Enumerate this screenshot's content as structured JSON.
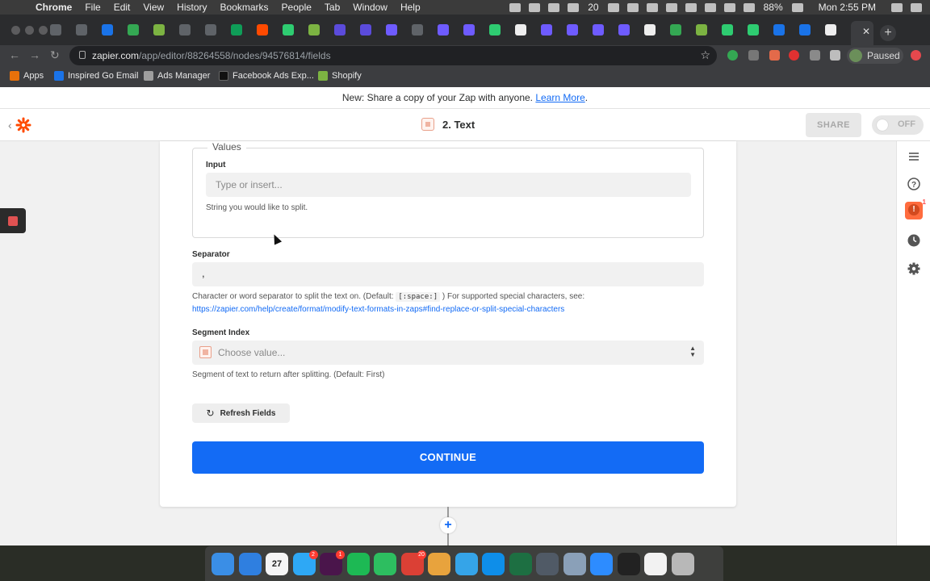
{
  "menubar": {
    "app": "Chrome",
    "items": [
      "File",
      "Edit",
      "View",
      "History",
      "Bookmarks",
      "People",
      "Tab",
      "Window",
      "Help"
    ],
    "badge_count": "20",
    "battery": "88%",
    "clock": "Mon 2:55 PM"
  },
  "tabs": {
    "colors": [
      "#5f6368",
      "#5f6368",
      "#1a73e8",
      "#34a853",
      "#7cb342",
      "#5f6368",
      "#5f6368",
      "#0f9d58",
      "#ff4a00",
      "#2ecc71",
      "#7cb342",
      "#5b4bdb",
      "#5b4bdb",
      "#6e5bff",
      "#5f6368",
      "#6e5bff",
      "#6e5bff",
      "#2ecc71",
      "#eeeeee",
      "#6e5bff",
      "#6e5bff",
      "#6e5bff",
      "#6e5bff",
      "#eeeeee",
      "#34a853",
      "#7cb342",
      "#2ecc71",
      "#2ecc71",
      "#1a73e8",
      "#1a73e8",
      "#eeeeee",
      "#1a73e8"
    ],
    "close_glyph": "✕",
    "new_tab_glyph": "+"
  },
  "address": {
    "host": "zapier.com",
    "path": "/app/editor/88264558/nodes/94576814/fields",
    "profile_status": "Paused"
  },
  "bookmarks": [
    {
      "label": "Apps",
      "color": "#e8710a"
    },
    {
      "label": "Inspired Go Email",
      "color": "#1a73e8"
    },
    {
      "label": "Ads Manager",
      "color": "#9e9e9e"
    },
    {
      "label": "Facebook Ads Exp...",
      "color": "#111111"
    },
    {
      "label": "Shopify",
      "color": "#7cb342"
    }
  ],
  "banner": {
    "text": "New: Share a copy of your Zap with anyone.",
    "link": "Learn More",
    "suffix": "."
  },
  "editor": {
    "step_title": "2. Text",
    "share_label": "SHARE",
    "toggle_label": "OFF",
    "alert_count": "1"
  },
  "form": {
    "values_legend": "Values",
    "input_label": "Input",
    "input_placeholder": "Type or insert...",
    "input_help": "String you would like to split.",
    "separator_label": "Separator",
    "separator_value": ",",
    "separator_help_prefix": "Character or word separator to split the text on. (Default:",
    "separator_default_code": "[:space:]",
    "separator_help_suffix": ") For supported special characters, see:",
    "separator_help_link": "https://zapier.com/help/create/format/modify-text-formats-in-zaps#find-replace-or-split-special-characters",
    "segment_label": "Segment Index",
    "segment_placeholder": "Choose value...",
    "segment_help": "Segment of text to return after splitting. (Default: First)",
    "refresh_label": "Refresh Fields",
    "continue_label": "CONTINUE"
  },
  "dock": {
    "icons": [
      {
        "name": "finder-icon",
        "color": "#3a8ee6"
      },
      {
        "name": "safari-icon",
        "color": "#2f7fe0"
      },
      {
        "name": "calendar-icon",
        "color": "#f5f5f5",
        "label": "27"
      },
      {
        "name": "messages-icon",
        "color": "#2ea8f5",
        "badge": "2"
      },
      {
        "name": "slack-icon",
        "color": "#4a154b",
        "badge": "1"
      },
      {
        "name": "spotify-icon",
        "color": "#1db954"
      },
      {
        "name": "evernote-icon",
        "color": "#2dbe60"
      },
      {
        "name": "todoist-icon",
        "color": "#db4035",
        "badge": "20"
      },
      {
        "name": "chrome-icon",
        "color": "#e8a33d"
      },
      {
        "name": "loom-icon",
        "color": "#35a4e8"
      },
      {
        "name": "teamviewer-icon",
        "color": "#0e8ee9"
      },
      {
        "name": "excel-icon",
        "color": "#1d6f42"
      },
      {
        "name": "monitor-icon",
        "color": "#505a66"
      },
      {
        "name": "preview-icon",
        "color": "#8aa0b8"
      },
      {
        "name": "zoom-icon",
        "color": "#2d8cff"
      },
      {
        "name": "activity-monitor-icon",
        "color": "#222222"
      },
      {
        "name": "webloc-file-icon",
        "color": "#f2f2f2"
      },
      {
        "name": "trash-icon",
        "color": "#b8b8b8"
      }
    ]
  }
}
